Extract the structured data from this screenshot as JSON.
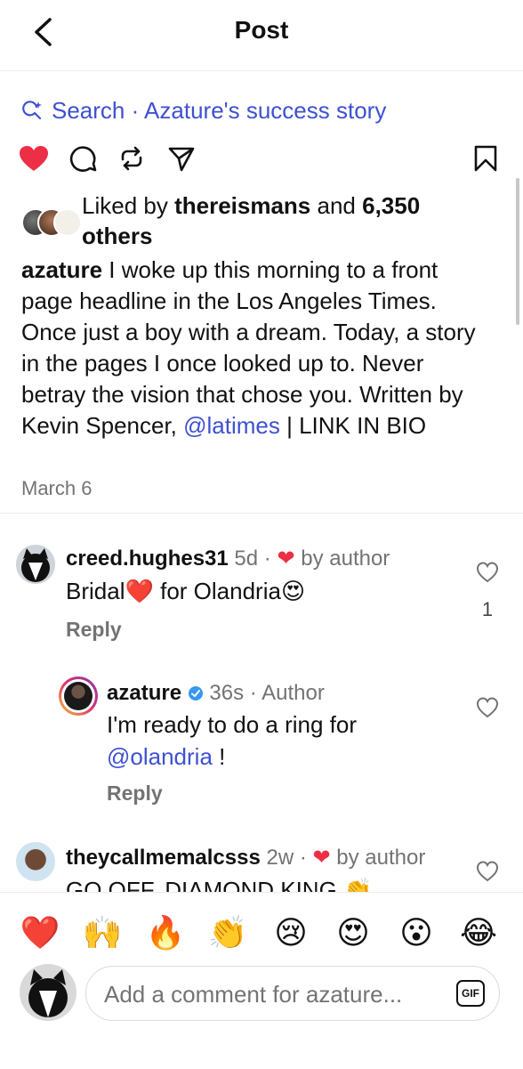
{
  "header": {
    "title": "Post"
  },
  "search": {
    "label": "Search · Azature's success story"
  },
  "actions": {
    "like": "heart-icon",
    "comment": "comment-icon",
    "repost": "repost-icon",
    "share": "send-icon",
    "save": "bookmark-icon"
  },
  "likes": {
    "prefix": "Liked by",
    "user": "thereismans",
    "and": "and",
    "count": "6,350",
    "suffix": "others"
  },
  "post": {
    "author": "azature",
    "caption_main": "I woke up this morning to a front page headline in the Los Angeles Times. Once just a boy with a dream. Today, a story in the pages I once looked up to. Never betray the vision that chose you. Written by Kevin Spencer,",
    "mention": "@latimes",
    "caption_tail": "| LINK IN BIO",
    "date": "March 6"
  },
  "comments": [
    {
      "user": "creed.hughes31",
      "time": "5d",
      "badge": "by author",
      "text_a": "Bridal",
      "emoji_a": "❤️",
      "text_b": "for Olandria",
      "emoji_b": "😍",
      "reply": "Reply",
      "likes": "1"
    },
    {
      "user": "azature",
      "time": "36s",
      "badge": "Author",
      "text": "I'm ready to do a ring for",
      "mention": "@olandria",
      "text_tail": "!",
      "reply": "Reply"
    },
    {
      "user": "theycallmemalcsss",
      "time": "2w",
      "badge": "by author",
      "text": "GO OFF, DIAMOND KING",
      "emoji": "👏"
    }
  ],
  "quick_reactions": [
    "❤️",
    "🙌",
    "🔥",
    "👏",
    "😢",
    "😍",
    "😮",
    "😂"
  ],
  "composer": {
    "placeholder": "Add a comment for azature...",
    "gif_label": "GIF"
  }
}
